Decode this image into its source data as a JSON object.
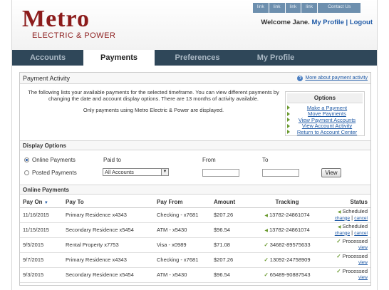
{
  "header": {
    "logo_main": "Metro",
    "logo_sub": "ELECTRIC & POWER",
    "top_links": [
      "link",
      "link",
      "link",
      "link",
      "Contact Us"
    ],
    "welcome_text": "Welcome Jane.",
    "my_profile": "My Profile",
    "separator": "|",
    "logout": "Logout"
  },
  "nav": {
    "tabs": [
      "Accounts",
      "Payments",
      "Preferences",
      "My Profile"
    ],
    "active": "Payments"
  },
  "panel": {
    "title": "Payment Activity",
    "more_link": "More about payment activity",
    "intro": "The following lists your available payments for the selected timeframe. You can view different payments by changing the date and account display options. There are 13 months of activity available.",
    "intro2": "Only payments using Metro Electric & Power are displayed."
  },
  "options": {
    "title": "Options",
    "items": [
      "Make a Payment",
      "Move Payments",
      "View Payment Accounts",
      "View Account Activity",
      "Return to Account Center"
    ]
  },
  "display_options": {
    "title": "Display Options",
    "radio_online": "Online Payments",
    "radio_posted": "Posted Payments",
    "paid_to_label": "Paid to",
    "paid_to_value": "All Accounts",
    "from_label": "From",
    "to_label": "To",
    "view_button": "View"
  },
  "online_payments": {
    "title": "Online Payments",
    "columns": [
      "Pay On",
      "Pay To",
      "Pay From",
      "Amount",
      "Tracking",
      "Status"
    ],
    "sort_indicator": "▼",
    "rows": [
      {
        "pay_on": "11/16/2015",
        "pay_to": "Primary Residence x4343",
        "pay_from": "Checking - x7681",
        "amount": "$207.26",
        "tracking": "13782-24861074",
        "status": "Scheduled",
        "actions": [
          "change",
          "cancel"
        ]
      },
      {
        "pay_on": "11/15/2015",
        "pay_to": "Secondary Residence x5454",
        "pay_from": "ATM - x5430",
        "amount": "$96.54",
        "tracking": "13782-24861074",
        "status": "Scheduled",
        "actions": [
          "change",
          "cancel"
        ]
      },
      {
        "pay_on": "9/5/2015",
        "pay_to": "Rental Property x7753",
        "pay_from": "Visa - x0989",
        "amount": "$71.08",
        "tracking": "34682-89575633",
        "status": "Processed",
        "actions": [
          "view"
        ]
      },
      {
        "pay_on": "9/7/2015",
        "pay_to": "Primary Residence x4343",
        "pay_from": "Checking - x7681",
        "amount": "$207.26",
        "tracking": "13092-24758909",
        "status": "Processed",
        "actions": [
          "view"
        ]
      },
      {
        "pay_on": "9/3/2015",
        "pay_to": "Secondary Residence x5454",
        "pay_from": "ATM - x5430",
        "amount": "$96.54",
        "tracking": "65489-90887543",
        "status": "Processed",
        "actions": [
          "view"
        ]
      }
    ]
  },
  "colors": {
    "brand": "#8c1c1c",
    "nav_bg": "#2f4759",
    "link": "#1f5aa6",
    "check": "#6a9a2e"
  }
}
